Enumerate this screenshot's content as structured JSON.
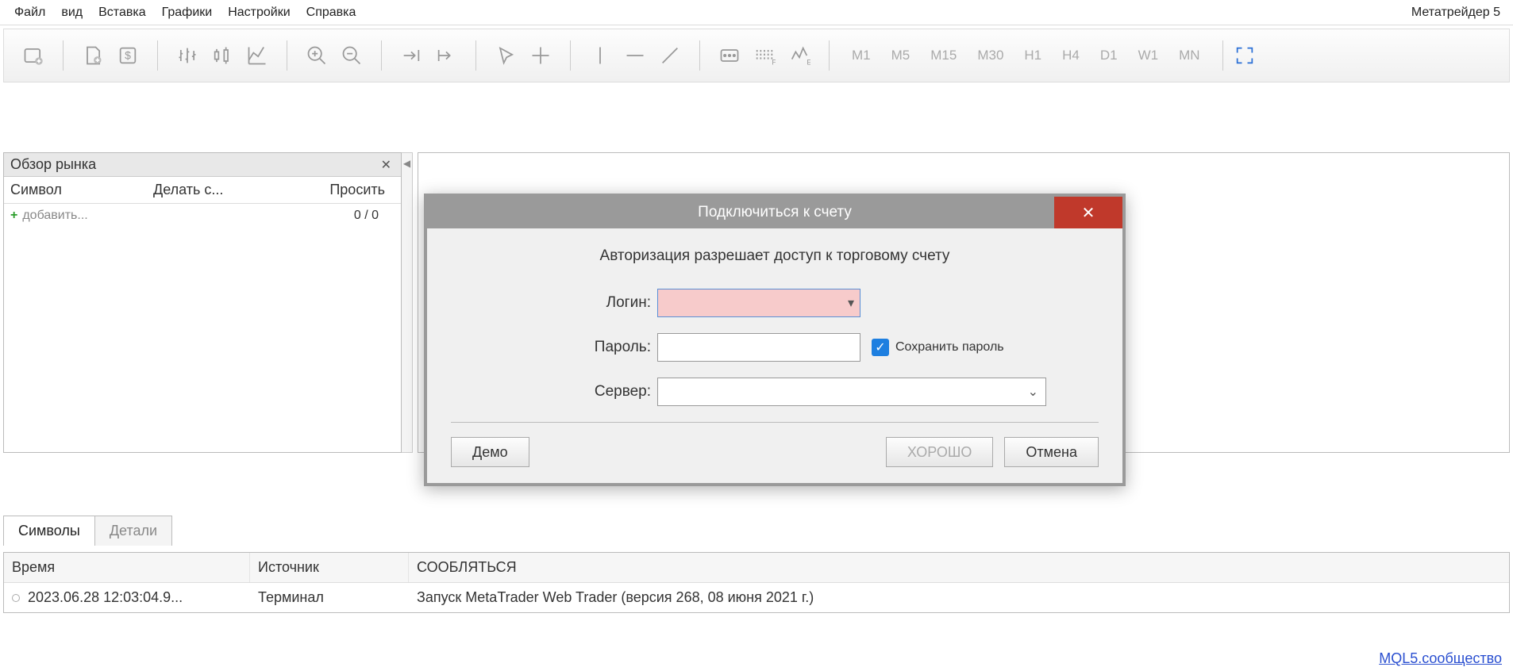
{
  "menubar": {
    "items": [
      "Файл",
      "вид",
      "Вставка",
      "Графики",
      "Настройки",
      "Справка"
    ],
    "app_title": "Метатрейдер 5"
  },
  "toolbar": {
    "timeframes": [
      "M1",
      "M5",
      "M15",
      "M30",
      "H1",
      "H4",
      "D1",
      "W1",
      "MN"
    ],
    "community_link": "MQL5.сообщество"
  },
  "market_watch": {
    "title": "Обзор рынка",
    "columns": {
      "symbol": "Символ",
      "bid": "Делать с...",
      "ask": "Просить"
    },
    "add_label": "добавить...",
    "ratio": "0 / 0",
    "tabs": {
      "symbols": "Символы",
      "details": "Детали"
    }
  },
  "log": {
    "columns": {
      "time": "Время",
      "source": "Источник",
      "message": "СООБЛЯТЬСЯ"
    },
    "row": {
      "time": "2023.06.28 12:03:04.9...",
      "source": "Терминал",
      "message": "Запуск MetaTrader Web Trader (версия 268, 08 июня 2021 г.)"
    }
  },
  "dialog": {
    "title": "Подключиться к счету",
    "desc": "Авторизация разрешает доступ к торговому счету",
    "login_label": "Логин:",
    "password_label": "Пароль:",
    "server_label": "Сервер:",
    "save_pwd_label": "Сохранить пароль",
    "demo": "Демо",
    "ok": "ХОРОШО",
    "cancel": "Отмена",
    "login_value": "",
    "password_value": "",
    "server_value": ""
  }
}
